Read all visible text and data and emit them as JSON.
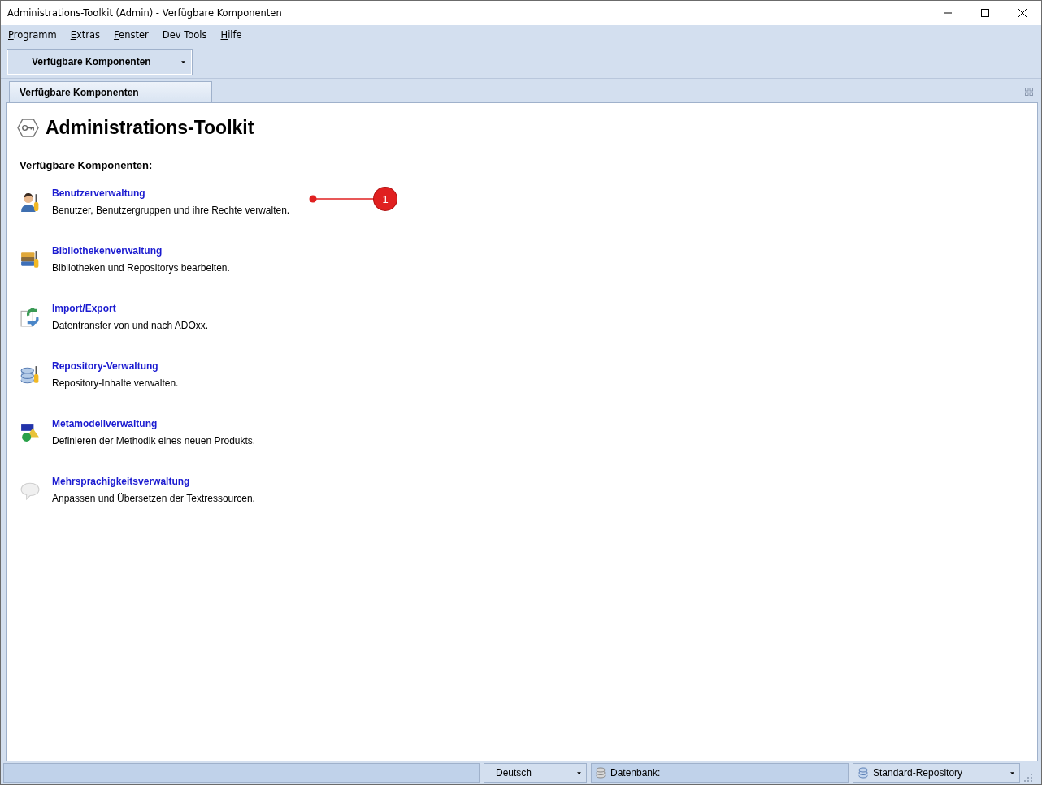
{
  "window": {
    "title": "Administrations-Toolkit (Admin) - Verfügbare Komponenten"
  },
  "menu": [
    {
      "label": "Programm",
      "underline_first": true
    },
    {
      "label": "Extras",
      "underline_first": true
    },
    {
      "label": "Fenster",
      "underline_first": true
    },
    {
      "label": "Dev Tools",
      "underline_first": false
    },
    {
      "label": "Hilfe",
      "underline_first": true
    }
  ],
  "toolbar": {
    "dropdown": "Verfügbare Komponenten"
  },
  "tabs": [
    {
      "label": "Verfügbare Komponenten",
      "selected": true
    }
  ],
  "page": {
    "title": "Administrations-Toolkit",
    "section": "Verfügbare Komponenten:",
    "components": [
      {
        "kind": "user",
        "name": "Benutzerverwaltung",
        "description": "Benutzer, Benutzergruppen und ihre Rechte verwalten.",
        "callout": "1"
      },
      {
        "kind": "library",
        "name": "Bibliothekenverwaltung",
        "description": "Bibliotheken und Repositorys bearbeiten."
      },
      {
        "kind": "import",
        "name": "Import/Export",
        "description": "Datentransfer von und nach ADOxx."
      },
      {
        "kind": "repository",
        "name": "Repository-Verwaltung",
        "description": "Repository-Inhalte verwalten."
      },
      {
        "kind": "metamodel",
        "name": "Metamodellverwaltung",
        "description": "Definieren der Methodik eines neuen Produkts."
      },
      {
        "kind": "language",
        "name": "Mehrsprachigkeitsverwaltung",
        "description": "Anpassen und Übersetzen der Textressourcen."
      }
    ]
  },
  "status_bar": {
    "language": "Deutsch",
    "database": "Datenbank:",
    "repository": "Standard-Repository"
  }
}
